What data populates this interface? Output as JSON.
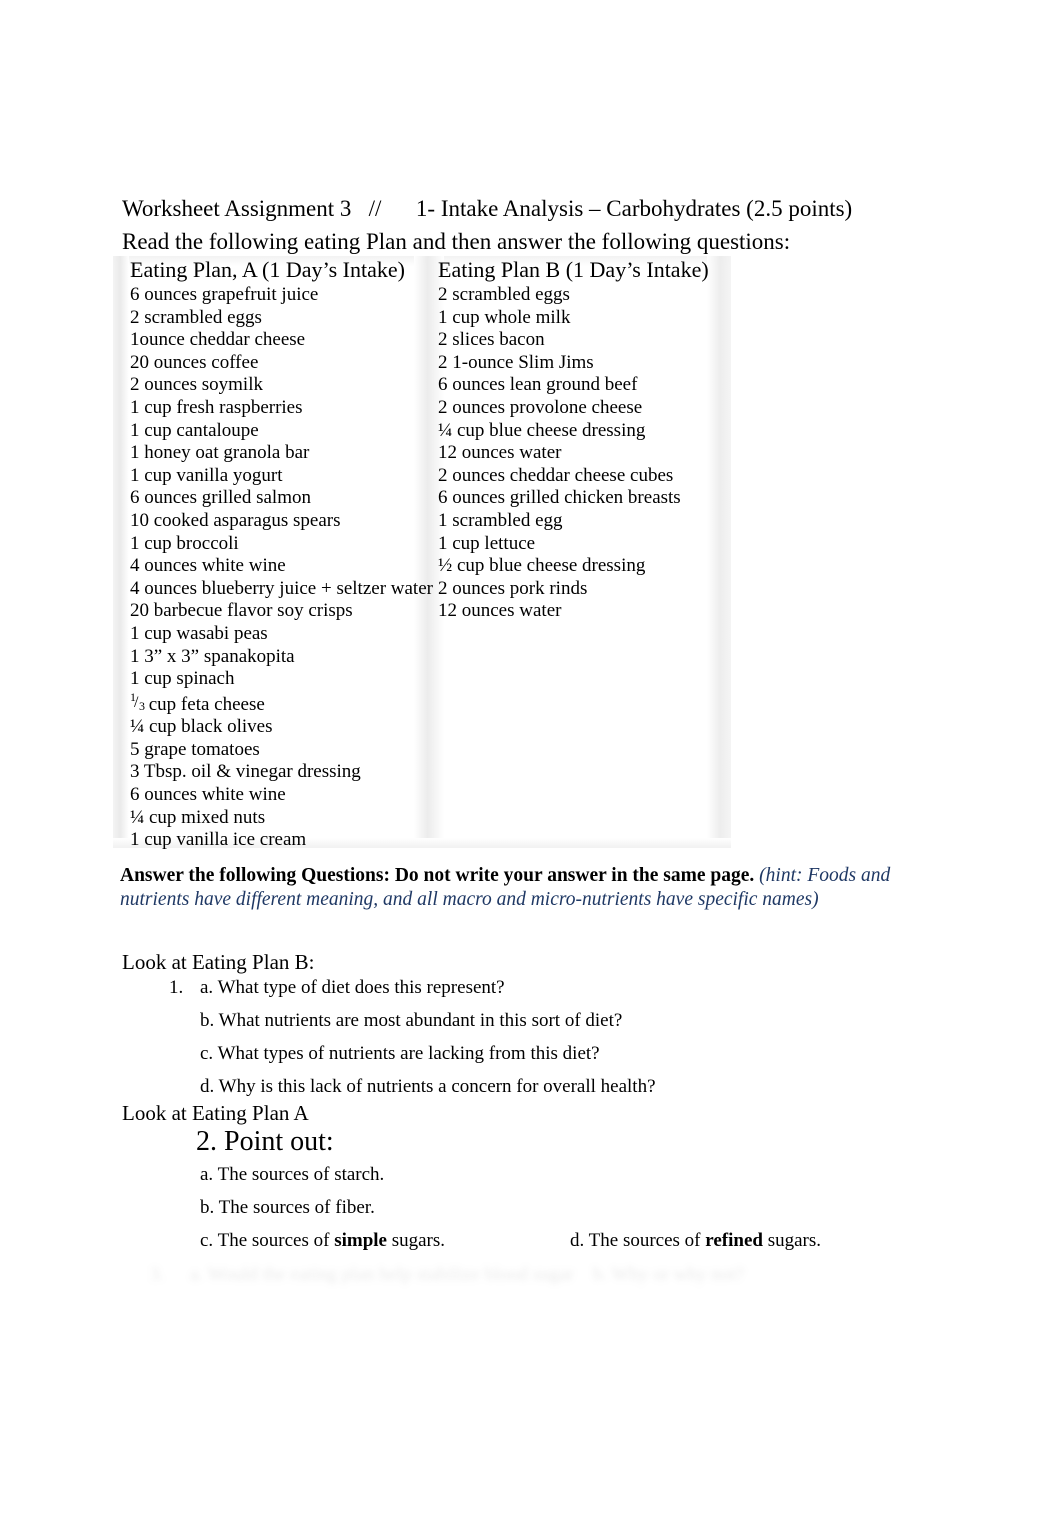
{
  "document": {
    "title_line": "Worksheet Assignment 3   //      1- Intake Analysis – Carbohydrates (2.5 points)",
    "subtitle_line": "Read the following eating Plan and then answer the following questions:"
  },
  "plans": {
    "plan_a": {
      "heading": "Eating Plan, A (1 Day’s Intake)",
      "items": [
        "6 ounces grapefruit juice",
        "2 scrambled eggs",
        "1ounce cheddar cheese",
        "20 ounces coffee",
        "2 ounces soymilk",
        "1 cup fresh raspberries",
        "1 cup cantaloupe",
        "1 honey oat granola bar",
        "1 cup vanilla yogurt",
        "6 ounces grilled salmon",
        "10 cooked asparagus spears",
        "1 cup broccoli",
        "4 ounces white wine",
        "4 ounces blueberry juice + seltzer water",
        "20 barbecue flavor soy crisps",
        "1 cup wasabi peas",
        "1 3” x 3” spanakopita",
        "1 cup spinach",
        "__FRAC_THIRD__ cup feta cheese",
        "¼ cup black olives",
        "5 grape tomatoes",
        "3 Tbsp. oil & vinegar dressing",
        "6 ounces white wine",
        "¼ cup mixed nuts",
        "1 cup vanilla ice cream"
      ]
    },
    "plan_b": {
      "heading": "Eating Plan B (1 Day’s Intake)",
      "items": [
        "2 scrambled eggs",
        "1 cup whole milk",
        "2 slices bacon",
        "2 1-ounce Slim Jims",
        "6 ounces lean ground beef",
        "2 ounces provolone cheese",
        "¼ cup blue cheese dressing",
        "12 ounces water",
        "2 ounces cheddar cheese cubes",
        "6 ounces grilled chicken breasts",
        "1 scrambled egg",
        "1 cup lettuce",
        "½ cup blue cheese dressing",
        "2 ounces pork rinds",
        "12 ounces water"
      ]
    }
  },
  "instruction": {
    "bold_text": "Answer the following Questions:  Do not write your answer in the same page.",
    "hint_text": " (hint: Foods and nutrients have different meaning, and all macro and micro-nutrients have specific names)",
    "hint_color": "#1f3864"
  },
  "questions": {
    "plan_b_lead": "Look at Eating Plan B:",
    "plan_b_number": "1.",
    "plan_b_items": [
      "a. What type of diet does this represent?",
      "b. What nutrients are most abundant in this sort of diet?",
      "c. What types of nutrients are lacking from this diet?",
      "d. Why is this lack of nutrients a concern for overall health?"
    ],
    "plan_a_lead": "Look at Eating Plan A",
    "plan_a_heading": "2.  Point out:",
    "plan_a_items": {
      "a": "a. The sources of starch.",
      "b": "b. The sources of fiber.",
      "c_pre": "c. The sources of ",
      "c_bold": "simple",
      "c_post": " sugars.",
      "d_pre": "d. The sources of ",
      "d_bold": "refined",
      "d_post": " sugars."
    },
    "cut_off_line": {
      "number": "3.",
      "pre": "a. Would the eating plan help stabilize blood sugar",
      "post": "b. Why or why not?"
    }
  }
}
